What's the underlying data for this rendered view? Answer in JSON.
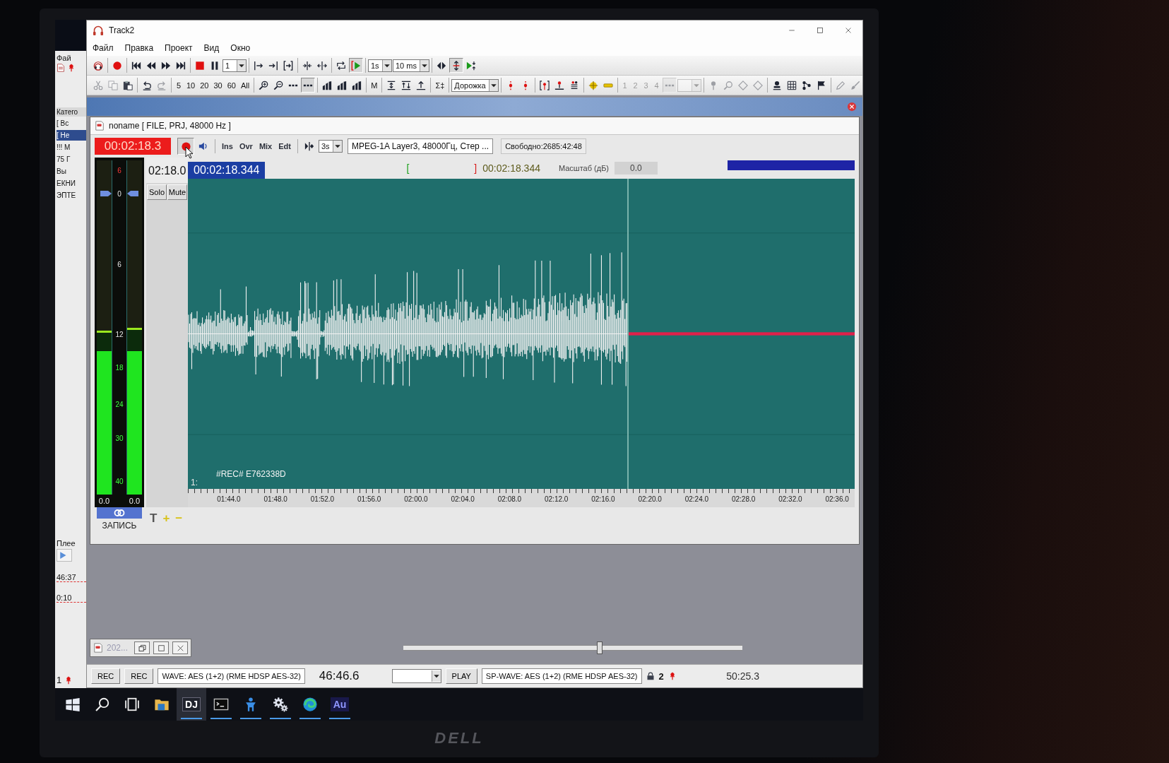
{
  "monitor": {
    "logo": "DELL"
  },
  "background_window": {
    "menu": "Фай",
    "list_header": "Катего",
    "list": [
      {
        "label": "[ Вс",
        "selected": false
      },
      {
        "label": "[ Не",
        "selected": true
      },
      {
        "label": "!!! М",
        "selected": false
      },
      {
        "label": "75 Г",
        "selected": false
      },
      {
        "label": "Вы",
        "selected": false
      },
      {
        "label": "ЕКНИ",
        "selected": false
      },
      {
        "label": "ЭПТЕ",
        "selected": false
      }
    ],
    "player_label": "Плее",
    "times": [
      "46:37",
      "0:10"
    ],
    "footer": "1"
  },
  "window": {
    "title": "Track2"
  },
  "menu": [
    "Файл",
    "Правка",
    "Проект",
    "Вид",
    "Окно"
  ],
  "toolbar_1": [
    [
      {
        "kind": "logo",
        "pressed": false,
        "disabled": false
      }
    ],
    [
      {
        "kind": "record",
        "pressed": false,
        "disabled": false
      }
    ],
    [
      {
        "kind": "first",
        "pressed": false,
        "disabled": false
      },
      {
        "kind": "rewind",
        "pressed": false,
        "disabled": false
      },
      {
        "kind": "forward",
        "pressed": false,
        "disabled": false
      },
      {
        "kind": "last",
        "pressed": false,
        "disabled": false
      }
    ],
    [
      {
        "kind": "stop",
        "pressed": false,
        "disabled": false
      },
      {
        "kind": "pause",
        "pressed": false,
        "disabled": false
      },
      {
        "kind": "dropdown",
        "value": "1",
        "pressed": false,
        "disabled": false
      }
    ],
    [
      {
        "kind": "markin",
        "pressed": false,
        "disabled": false
      },
      {
        "kind": "markout",
        "pressed": false,
        "disabled": false
      },
      {
        "kind": "region",
        "pressed": false,
        "disabled": false
      }
    ],
    [
      {
        "kind": "split",
        "pressed": false,
        "disabled": false
      },
      {
        "kind": "join",
        "pressed": false,
        "disabled": false
      }
    ],
    [
      {
        "kind": "loop",
        "pressed": false,
        "disabled": false
      },
      {
        "kind": "playsel",
        "pressed": true,
        "disabled": false
      }
    ],
    [
      {
        "kind": "dropdown",
        "value": "1s",
        "pressed": false,
        "disabled": false
      },
      {
        "kind": "dropdown",
        "value": "10 ms",
        "pressed": false,
        "disabled": false
      }
    ],
    [
      {
        "kind": "spread",
        "pressed": false,
        "disabled": false
      },
      {
        "kind": "vzoom",
        "pressed": true,
        "disabled": false
      },
      {
        "kind": "playcur",
        "pressed": false,
        "disabled": false
      }
    ]
  ],
  "toolbar_2": [
    [
      {
        "kind": "cut",
        "pressed": false,
        "disabled": true
      },
      {
        "kind": "copy",
        "pressed": false,
        "disabled": true
      },
      {
        "kind": "paste",
        "pressed": false,
        "disabled": false
      }
    ],
    [
      {
        "kind": "undo",
        "pressed": false,
        "disabled": false
      },
      {
        "kind": "redo",
        "pressed": false,
        "disabled": true
      }
    ],
    [
      {
        "kind": "text",
        "label": "5",
        "pressed": false,
        "disabled": false
      },
      {
        "kind": "text",
        "label": "10",
        "pressed": false,
        "disabled": false
      },
      {
        "kind": "text",
        "label": "20",
        "pressed": false,
        "disabled": false
      },
      {
        "kind": "text",
        "label": "30",
        "pressed": false,
        "disabled": false
      },
      {
        "kind": "text",
        "label": "60",
        "pressed": false,
        "disabled": false
      },
      {
        "kind": "text",
        "label": "All",
        "pressed": false,
        "disabled": false
      }
    ],
    [
      {
        "kind": "zoomin",
        "pressed": false,
        "disabled": false
      },
      {
        "kind": "zoomout",
        "pressed": false,
        "disabled": false
      },
      {
        "kind": "dots",
        "pressed": false,
        "disabled": false
      },
      {
        "kind": "dots",
        "pressed": true,
        "disabled": false
      }
    ],
    [
      {
        "kind": "bars",
        "pressed": false,
        "disabled": false
      },
      {
        "kind": "bars",
        "pressed": false,
        "disabled": false
      },
      {
        "kind": "bars",
        "pressed": false,
        "disabled": false
      }
    ],
    [
      {
        "kind": "text",
        "label": "M",
        "pressed": false,
        "disabled": false
      }
    ],
    [
      {
        "kind": "vsel",
        "pressed": false,
        "disabled": false
      },
      {
        "kind": "fit",
        "pressed": false,
        "disabled": false
      },
      {
        "kind": "up",
        "pressed": false,
        "disabled": false
      }
    ],
    [
      {
        "kind": "text",
        "label": "Σ‡",
        "pressed": false,
        "disabled": false
      }
    ],
    [
      {
        "kind": "dropdown",
        "value": "Дорожка",
        "pressed": false,
        "disabled": false
      }
    ],
    [
      {
        "kind": "marker",
        "pressed": false,
        "disabled": false
      },
      {
        "kind": "marker",
        "pressed": false,
        "disabled": false
      }
    ],
    [
      {
        "kind": "mbracket",
        "pressed": false,
        "disabled": false
      },
      {
        "kind": "mline",
        "pressed": false,
        "disabled": false
      },
      {
        "kind": "mstack",
        "pressed": false,
        "disabled": false
      }
    ],
    [
      {
        "kind": "crosshair",
        "pressed": false,
        "disabled": false
      },
      {
        "kind": "dash",
        "pressed": false,
        "disabled": false
      }
    ],
    [
      {
        "kind": "text",
        "label": "1",
        "pressed": false,
        "disabled": true
      },
      {
        "kind": "text",
        "label": "2",
        "pressed": false,
        "disabled": true
      },
      {
        "kind": "text",
        "label": "3",
        "pressed": false,
        "disabled": true
      },
      {
        "kind": "text",
        "label": "4",
        "pressed": false,
        "disabled": true
      },
      {
        "kind": "dots",
        "pressed": true,
        "disabled": true
      },
      {
        "kind": "dropdown",
        "pressed": false,
        "disabled": true
      }
    ],
    [
      {
        "kind": "pin",
        "pressed": false,
        "disabled": true
      },
      {
        "kind": "glass",
        "pressed": false,
        "disabled": true
      },
      {
        "kind": "diamond",
        "pressed": false,
        "disabled": true
      },
      {
        "kind": "diamond",
        "pressed": false,
        "disabled": true
      }
    ],
    [
      {
        "kind": "stamp",
        "pressed": false,
        "disabled": false
      },
      {
        "kind": "grid",
        "pressed": false,
        "disabled": false
      },
      {
        "kind": "branch",
        "pressed": false,
        "disabled": false
      },
      {
        "kind": "flag",
        "pressed": false,
        "disabled": false
      }
    ],
    [
      {
        "kind": "pencil",
        "pressed": false,
        "disabled": true
      },
      {
        "kind": "brush",
        "pressed": false,
        "disabled": true
      }
    ]
  ],
  "document": {
    "title": "noname [ FILE, PRJ, 48000 Hz ]",
    "time_display": "00:02:18.3",
    "record_button": {
      "pressed": true
    },
    "modes": [
      {
        "label": "Ins",
        "selected": false
      },
      {
        "label": "Ovr",
        "selected": false
      },
      {
        "label": "Mix",
        "selected": false
      },
      {
        "label": "Edt",
        "selected": false
      }
    ],
    "pre_roll": "3s",
    "format": "MPEG-1A Layer3, 48000Гц, Стер ...",
    "free_space": "Свободно:2685:42:48",
    "selection_start": "[",
    "selection_end": "]",
    "cursor_time": "00:02:18.344",
    "scale_label": "Масштаб (дБ)",
    "scale_value": "0.0",
    "meter": {
      "scale": [
        "6",
        "0",
        "6",
        "12",
        "18",
        "24",
        "30",
        "40"
      ],
      "handle": {
        "level": 0.9
      },
      "channels": [
        {
          "level": 0.43,
          "peak": {
            "level": 0.49
          },
          "reading": "0.0"
        },
        {
          "level": 0.43,
          "peak": {
            "level": 0.5
          },
          "reading": "0.0"
        }
      ],
      "label": "ЗАПИСЬ"
    },
    "track": {
      "time": "02:18.0",
      "buttons": [
        {
          "label": "Solo",
          "selected": false
        },
        {
          "label": "Mute",
          "selected": false
        }
      ],
      "tools": [
        "T",
        "+",
        "−"
      ],
      "position": "00:02:18.344",
      "number": "1:",
      "clip": "#REC# E762338D",
      "recorded": {
        "level": 0.66
      },
      "ruler": [
        "01:44.0",
        "01:48.0",
        "01:52.0",
        "01:56.0",
        "02:00.0",
        "02:04.0",
        "02:08.0",
        "02:12.0",
        "02:16.0",
        "02:20.0",
        "02:24.0",
        "02:28.0",
        "02:32.0",
        "02:36.0"
      ]
    }
  },
  "minimized_window": {
    "title": "202..."
  },
  "position_slider": {
    "level": 0.58
  },
  "status_bar": {
    "buttons": [
      "REC",
      "REC"
    ],
    "input_device": "WAVE: AES (1+2) (RME HDSP AES-32)",
    "input_time": "46:46.6",
    "play_button": "PLAY",
    "output_device": "SP-WAVE: AES (1+2) (RME HDSP AES-32)",
    "output_channels": "2",
    "output_time": "50:25.3"
  },
  "taskbar": [
    {
      "kind": "start",
      "running": false,
      "selected": false
    },
    {
      "kind": "search",
      "running": false,
      "selected": false
    },
    {
      "kind": "taskview",
      "running": false,
      "selected": false
    },
    {
      "kind": "folder",
      "running": false,
      "selected": false
    },
    {
      "kind": "app",
      "label": "DJ",
      "running": true,
      "selected": true
    },
    {
      "kind": "terminal",
      "running": true,
      "selected": false
    },
    {
      "kind": "figure",
      "running": true,
      "selected": false
    },
    {
      "kind": "gear",
      "running": true,
      "selected": false
    },
    {
      "kind": "edge",
      "running": true,
      "selected": false
    },
    {
      "kind": "app",
      "label": "Au",
      "running": true,
      "selected": false
    }
  ]
}
